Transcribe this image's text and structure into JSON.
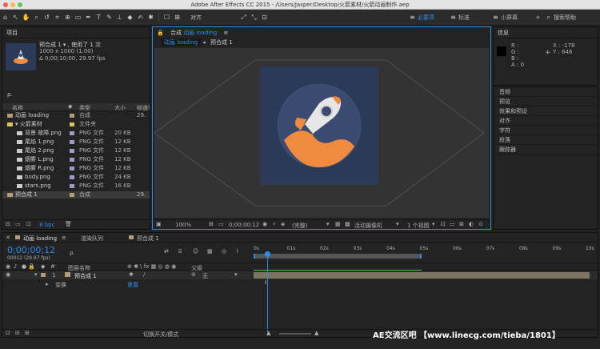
{
  "app": {
    "title": "Adobe After Effects CC 2015 - /Users/Jasper/Desktop/火箭素材/火箭动画制作.aep"
  },
  "toolbar": {
    "icons": [
      "selection-tool",
      "hand-tool",
      "zoom-tool",
      "rotate-tool",
      "camera-tool",
      "pan-tool",
      "mask-tool",
      "pen-tool",
      "type-tool",
      "brush-tool",
      "clone-tool",
      "eraser-tool",
      "roto-tool",
      "puppet-tool"
    ],
    "align": "对齐",
    "workspace": "必要项",
    "standard": "标准",
    "small_screen": "小屏幕",
    "search": "搜索帮助"
  },
  "project": {
    "title": "项目",
    "comp_name": "预合成 1 ▾ , 使用了 1 次",
    "size": "1000 x 1000 (1.00)",
    "duration": "Δ 0;00;10;00, 29.97 fps",
    "search": "ρ.",
    "cols": [
      "名称",
      "类型",
      "大小",
      "帧速率"
    ],
    "items": [
      {
        "name": "动画 loading",
        "type": "合成",
        "size": "",
        "fps": "29.",
        "color": "#b39c7a",
        "icon": "comp"
      },
      {
        "name": "▾ 火箭素材",
        "type": "文件夹",
        "size": "",
        "fps": "",
        "color": "#d9c461",
        "icon": "folder"
      },
      {
        "name": "背景 故障.png",
        "type": "PNG 文件",
        "size": "20 KB",
        "fps": "",
        "color": "#9c9ccc",
        "icon": "file"
      },
      {
        "name": "尾焰 1.png",
        "type": "PNG 文件",
        "size": "12 KB",
        "fps": "",
        "color": "#9c9ccc",
        "icon": "file"
      },
      {
        "name": "尾焰 2.png",
        "type": "PNG 文件",
        "size": "12 KB",
        "fps": "",
        "color": "#9c9ccc",
        "icon": "file"
      },
      {
        "name": "烟雾 L.png",
        "type": "PNG 文件",
        "size": "12 KB",
        "fps": "",
        "color": "#9c9ccc",
        "icon": "file"
      },
      {
        "name": "烟雾 R.png",
        "type": "PNG 文件",
        "size": "12 KB",
        "fps": "",
        "color": "#9c9ccc",
        "icon": "file"
      },
      {
        "name": "body.png",
        "type": "PNG 文件",
        "size": "24 KB",
        "fps": "",
        "color": "#9c9ccc",
        "icon": "file"
      },
      {
        "name": "stars.png",
        "type": "PNG 文件",
        "size": "16 KB",
        "fps": "",
        "color": "#9c9ccc",
        "icon": "file"
      },
      {
        "name": "预合成 1",
        "type": "合成",
        "size": "",
        "fps": "29.",
        "color": "#b39c7a",
        "icon": "comp"
      }
    ],
    "bpc": "8 bpc"
  },
  "composition": {
    "tab": "合成 动画 loading",
    "tab_prefix": "合成",
    "tab_name": "动画 loading",
    "crumbs": [
      "动画 loading",
      "预合成 1"
    ],
    "zoom": "100%",
    "time": "0;00;00;12",
    "quality": "(完整)",
    "camera": "活动摄像机",
    "views": "1 个视图"
  },
  "info": {
    "title": "信息",
    "r": "R :",
    "g": "G :",
    "b": "B :",
    "a": "A : 0",
    "x": "X : -178",
    "y": "Y : 646"
  },
  "side_panels": [
    "音频",
    "预览",
    "效果和预设",
    "对齐",
    "字符",
    "段落",
    "跟踪器"
  ],
  "timeline": {
    "tabs": [
      "动画 loading",
      "渲染队列",
      "预合成 1"
    ],
    "time": "0;00;00;12",
    "fps": "00012 (29.97 fps)",
    "search": "ρ.",
    "layer_col": "图层名称",
    "parent_col": "父级",
    "ticks": [
      "0s",
      "01s",
      "02s",
      "03s",
      "04s",
      "05s",
      "06s",
      "07s",
      "08s",
      "09s",
      "10s"
    ],
    "layer": {
      "num": "1",
      "name": "预合成 1",
      "parent": "无"
    },
    "transform": "变换",
    "reset": "重置",
    "footer": "切换开关/模式"
  },
  "watermark": "AE交流区吧 【www.linecg.com/tieba/1801】",
  "colors": {
    "accent": "#2d8ceb",
    "rocket_bg": "#2a3a58",
    "planet": "#ef8a3e",
    "layer_bar": "#7d7563"
  }
}
